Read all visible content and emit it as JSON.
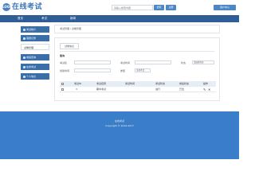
{
  "header": {
    "logo_text": "LOGO",
    "site_title": "在线考试",
    "search_placeholder": "请输入搜索内容",
    "search_label": "搜索",
    "register_label": "注册",
    "user_label": "用户中心"
  },
  "nav": {
    "items": [
      {
        "label": "首页"
      },
      {
        "label": "考试"
      },
      {
        "label": "新闻"
      }
    ]
  },
  "sidebar": {
    "items": [
      {
        "label": "考试统计",
        "active": false
      },
      {
        "label": "错题记录",
        "active": false
      },
      {
        "label": "试卷管理",
        "active": true
      },
      {
        "label": "成绩查询",
        "active": false
      },
      {
        "label": "在线考试",
        "active": false
      },
      {
        "label": "个人信息",
        "active": false
      }
    ]
  },
  "breadcrumb": {
    "text": "考试管理 / 试卷管理"
  },
  "panel": {
    "tab_label": "试卷信息",
    "filter_title": "查询",
    "fields": {
      "exam_name_label": "考试名",
      "exam_time_label": "考试时间",
      "status_label": "状态",
      "status_value": "请选择状态",
      "create_time_label": "创建时间",
      "type_label": "类型",
      "type_value": "全部考试"
    }
  },
  "table": {
    "headers": [
      "考试ID",
      "考试名称",
      "考试时间",
      "考试状态",
      "成绩状态",
      "操作"
    ],
    "rows": [
      {
        "id": "3",
        "name": "期中考试",
        "time": "",
        "status": "进行",
        "score_status": "已出"
      }
    ],
    "action_icons": [
      "edit-icon",
      "delete-icon"
    ]
  },
  "footer": {
    "line1": "在线考试",
    "line2": "Copyright © 2016-2017"
  },
  "colors": {
    "brand": "#3b74b8",
    "nav_bg": "#2f5e96",
    "button_bg": "#4a86c8",
    "sidebar_bg": "#3a6ea8",
    "footer_bg": "#3a7dc9"
  }
}
